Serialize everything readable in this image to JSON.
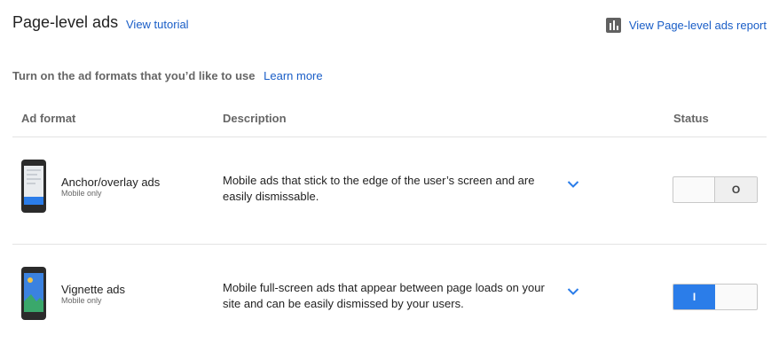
{
  "header": {
    "title": "Page-level ads",
    "tutorial_link": "View tutorial",
    "report_link": "View Page-level ads report",
    "report_icon": "bar-chart-icon"
  },
  "intro": {
    "text": "Turn on the ad formats that you’d like to use",
    "learn_more": "Learn more"
  },
  "table": {
    "columns": [
      "Ad format",
      "Description",
      "Status"
    ],
    "rows": [
      {
        "name": "Anchor/overlay ads",
        "subtitle": "Mobile only",
        "description": "Mobile ads that stick to the edge of the user’s screen and are easily dismissable.",
        "status_label": "O",
        "status_on": false
      },
      {
        "name": "Vignette ads",
        "subtitle": "Mobile only",
        "description": "Mobile full-screen ads that appear between page loads on your site and can be easily dismissed by your users.",
        "status_label": "I",
        "status_on": true
      }
    ]
  },
  "colors": {
    "link": "#1a5ec7",
    "toggle_on": "#2b7de9"
  }
}
